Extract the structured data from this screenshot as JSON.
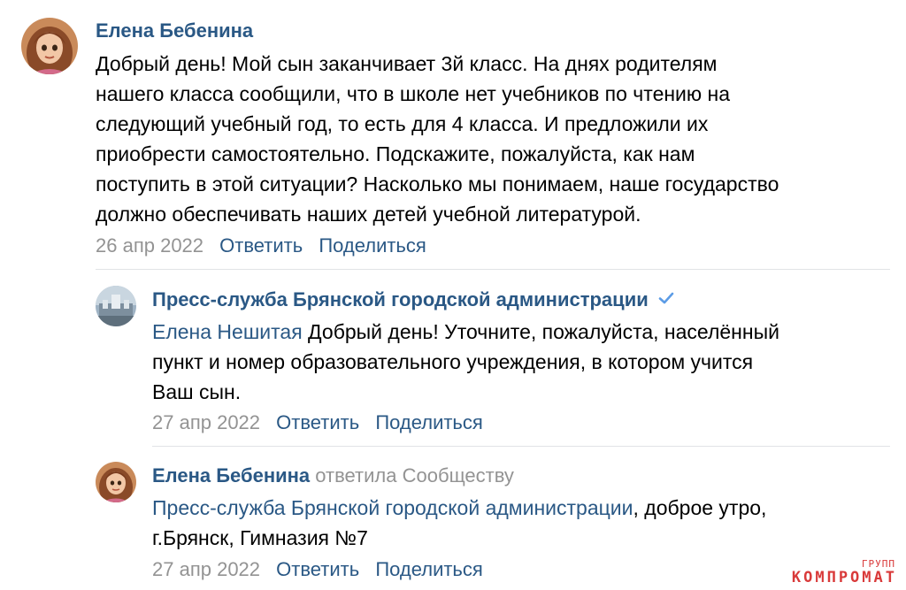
{
  "comments": [
    {
      "author": "Елена Бебенина",
      "lines": [
        "Добрый день! Мой сын заканчивает 3й класс. На днях родителям",
        "нашего класса сообщили, что в школе нет учебников по чтению на",
        "следующий учебный год, то есть для 4 класса. И предложили их",
        "приобрести самостоятельно. Подскажите, пожалуйста, как нам",
        "поступить в этой ситуации? Насколько мы понимаем, наше государство",
        "должно обеспечивать наших детей учебной литературой."
      ],
      "date": "26 апр 2022",
      "reply": "Ответить",
      "share": "Поделиться"
    },
    {
      "author": "Пресс-служба Брянской городской администрации",
      "verified_icon": "checkmark-icon",
      "mention": "Елена Нешитая",
      "line1_rest": " Добрый день! Уточните, пожалуйста, населённый",
      "line2": "пункт и номер образовательного учреждения, в котором учится",
      "line3": "Ваш сын.",
      "date": "27 апр 2022",
      "reply": "Ответить",
      "share": "Поделиться"
    },
    {
      "author": "Елена Бебенина",
      "replied_to": "ответила Сообществу",
      "mention": "Пресс-служба Брянской городской администрации",
      "line1_rest": ", доброе утро,",
      "line2": "г.Брянск, Гимназия №7",
      "date": "27 апр 2022",
      "reply": "Ответить",
      "share": "Поделиться"
    }
  ],
  "colors": {
    "link": "#2a5885",
    "meta": "#939393",
    "divider": "#e1e3e6",
    "verified": "#5c9ce6",
    "watermark": "#d93a3a"
  },
  "watermark": {
    "top": "ГРУПП",
    "main": "КОМПРОМАТ"
  }
}
